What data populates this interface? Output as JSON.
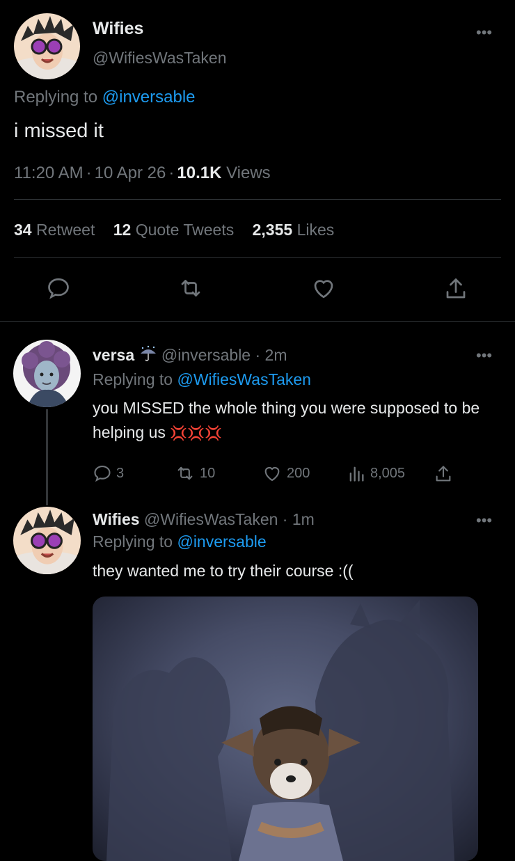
{
  "main_tweet": {
    "name": "Wifies",
    "handle": "@WifiesWasTaken",
    "replying_prefix": "Replying to",
    "replying_handle": "@inversable",
    "text": "i missed it",
    "time": "11:20 AM",
    "date": "10 Apr 26",
    "views_count": "10.1K",
    "views_label": "Views",
    "retweets_count": "34",
    "retweets_label": "Retweet",
    "quotes_count": "12",
    "quotes_label": "Quote Tweets",
    "likes_count": "2,355",
    "likes_label": "Likes"
  },
  "reply1": {
    "name": "versa",
    "handle": "@inversable",
    "time": "2m",
    "replying_prefix": "Replying to",
    "replying_handle": "@WifiesWasTaken",
    "text": "you MISSED the whole thing you were supposed to be helping us",
    "emoji": "💢💢💢",
    "replies": "3",
    "retweets": "10",
    "likes": "200",
    "views": "8,005"
  },
  "reply2": {
    "name": "Wifies",
    "handle": "@WifiesWasTaken",
    "time": "1m",
    "replying_prefix": "Replying to",
    "replying_handle": "@inversable",
    "text": "they wanted me to try their course :(("
  },
  "icons": {
    "more": "more-icon",
    "reply": "reply-icon",
    "retweet": "retweet-icon",
    "like": "heart-icon",
    "share": "share-icon",
    "views": "views-icon",
    "umbrella": "umbrella-icon"
  },
  "colors": {
    "background": "#000000",
    "text": "#e7e9ea",
    "secondary": "#71767b",
    "accent": "#1d9bf0",
    "divider": "#2f3336",
    "anger_emoji": "#e0245e"
  }
}
